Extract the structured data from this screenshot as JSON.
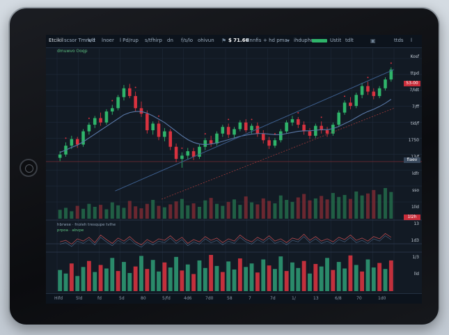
{
  "toolbar": {
    "items": [
      "Etcikil",
      "scsor Tmrwd",
      "k/lt",
      "lnoer",
      "l Pd/rup",
      "s/tfhirp",
      "dn",
      "f/s/lo",
      "ohivun",
      "Ennfis",
      "+ hd pma",
      "ihdup",
      "ho",
      "Ustit",
      "tdlt",
      "ttds"
    ],
    "price": "$ 71.60",
    "mini_value": "l"
  },
  "subtitle": "dmuwvo Ooqp",
  "price_axis": {
    "labels": [
      "Kosf",
      "ttpd",
      "7/ldt",
      "7/ff",
      "tid/f",
      "1750",
      "13/f",
      "ldfr",
      "sso",
      "1lld",
      "13",
      "1d3",
      "1/3",
      "lld"
    ],
    "badges": [
      "53-00",
      "fiaev",
      "1l2h"
    ]
  },
  "indicator_title": "hbrwse · fnoleh tresqupe tvlhe",
  "indicator_sub": "prpoa · abvpe",
  "time_axis": [
    "Hifd",
    "5ld",
    "fd",
    "5d",
    "80",
    "5/fd",
    "4d6",
    "7d0",
    "58",
    "7",
    "7d",
    "1/",
    "13",
    "6/8",
    "70",
    "1d0"
  ],
  "colors": {
    "up": "#2fb46a",
    "down": "#d8323f",
    "ma": "#5a79a8",
    "grid": "#1f2b3a"
  },
  "chart_data": {
    "type": "candlestick",
    "up_color": "#2fb46a",
    "down_color": "#d8323f",
    "candles": [
      {
        "o": 56.0,
        "h": 57.2,
        "l": 55.4,
        "c": 56.6
      },
      {
        "o": 56.6,
        "h": 58.8,
        "l": 56.2,
        "c": 58.2
      },
      {
        "o": 58.2,
        "h": 60.0,
        "l": 57.6,
        "c": 59.4
      },
      {
        "o": 59.4,
        "h": 59.8,
        "l": 57.8,
        "c": 58.4
      },
      {
        "o": 58.4,
        "h": 61.2,
        "l": 58.0,
        "c": 60.8
      },
      {
        "o": 60.8,
        "h": 62.4,
        "l": 60.2,
        "c": 62.0
      },
      {
        "o": 62.0,
        "h": 63.6,
        "l": 61.4,
        "c": 63.2
      },
      {
        "o": 63.2,
        "h": 64.2,
        "l": 61.8,
        "c": 62.4
      },
      {
        "o": 62.4,
        "h": 64.8,
        "l": 62.0,
        "c": 64.4
      },
      {
        "o": 64.4,
        "h": 65.6,
        "l": 63.8,
        "c": 65.0
      },
      {
        "o": 65.0,
        "h": 67.4,
        "l": 64.6,
        "c": 67.0
      },
      {
        "o": 67.0,
        "h": 69.2,
        "l": 66.4,
        "c": 68.6
      },
      {
        "o": 68.6,
        "h": 69.4,
        "l": 66.8,
        "c": 67.2
      },
      {
        "o": 67.2,
        "h": 68.0,
        "l": 64.4,
        "c": 65.0
      },
      {
        "o": 65.0,
        "h": 66.2,
        "l": 63.4,
        "c": 64.0
      },
      {
        "o": 64.0,
        "h": 64.6,
        "l": 60.4,
        "c": 61.0
      },
      {
        "o": 61.0,
        "h": 62.6,
        "l": 60.2,
        "c": 62.2
      },
      {
        "o": 62.2,
        "h": 62.8,
        "l": 59.2,
        "c": 59.8
      },
      {
        "o": 59.8,
        "h": 61.4,
        "l": 59.0,
        "c": 60.8
      },
      {
        "o": 60.8,
        "h": 61.2,
        "l": 57.4,
        "c": 58.0
      },
      {
        "o": 58.0,
        "h": 58.6,
        "l": 55.2,
        "c": 55.8
      },
      {
        "o": 55.8,
        "h": 57.0,
        "l": 54.2,
        "c": 56.4
      },
      {
        "o": 56.4,
        "h": 57.8,
        "l": 55.8,
        "c": 57.2
      },
      {
        "o": 57.2,
        "h": 57.8,
        "l": 55.6,
        "c": 56.2
      },
      {
        "o": 56.2,
        "h": 58.4,
        "l": 55.8,
        "c": 58.0
      },
      {
        "o": 58.0,
        "h": 59.6,
        "l": 57.4,
        "c": 59.2
      },
      {
        "o": 59.2,
        "h": 60.0,
        "l": 58.0,
        "c": 58.6
      },
      {
        "o": 58.6,
        "h": 60.8,
        "l": 58.2,
        "c": 60.4
      },
      {
        "o": 60.4,
        "h": 62.0,
        "l": 59.8,
        "c": 61.6
      },
      {
        "o": 61.6,
        "h": 62.2,
        "l": 59.6,
        "c": 60.2
      },
      {
        "o": 60.2,
        "h": 61.6,
        "l": 59.6,
        "c": 61.2
      },
      {
        "o": 61.2,
        "h": 62.8,
        "l": 60.8,
        "c": 62.4
      },
      {
        "o": 62.4,
        "h": 63.0,
        "l": 60.6,
        "c": 61.0
      },
      {
        "o": 61.0,
        "h": 62.2,
        "l": 60.4,
        "c": 61.8
      },
      {
        "o": 61.8,
        "h": 62.4,
        "l": 59.8,
        "c": 60.4
      },
      {
        "o": 60.4,
        "h": 61.0,
        "l": 58.6,
        "c": 59.2
      },
      {
        "o": 59.2,
        "h": 59.8,
        "l": 57.6,
        "c": 58.2
      },
      {
        "o": 58.2,
        "h": 59.6,
        "l": 57.8,
        "c": 59.2
      },
      {
        "o": 59.2,
        "h": 61.2,
        "l": 58.8,
        "c": 60.8
      },
      {
        "o": 60.8,
        "h": 62.8,
        "l": 60.4,
        "c": 62.4
      },
      {
        "o": 62.4,
        "h": 63.6,
        "l": 61.8,
        "c": 63.0
      },
      {
        "o": 63.0,
        "h": 63.4,
        "l": 61.4,
        "c": 62.0
      },
      {
        "o": 62.0,
        "h": 62.6,
        "l": 60.2,
        "c": 60.8
      },
      {
        "o": 60.8,
        "h": 61.4,
        "l": 59.4,
        "c": 60.0
      },
      {
        "o": 60.0,
        "h": 62.2,
        "l": 59.6,
        "c": 61.8
      },
      {
        "o": 61.8,
        "h": 62.6,
        "l": 60.4,
        "c": 61.0
      },
      {
        "o": 61.0,
        "h": 61.6,
        "l": 59.8,
        "c": 60.4
      },
      {
        "o": 60.4,
        "h": 62.4,
        "l": 60.0,
        "c": 62.0
      },
      {
        "o": 62.0,
        "h": 64.6,
        "l": 61.6,
        "c": 64.2
      },
      {
        "o": 64.2,
        "h": 66.4,
        "l": 63.8,
        "c": 66.0
      },
      {
        "o": 66.0,
        "h": 67.0,
        "l": 64.8,
        "c": 65.4
      },
      {
        "o": 65.4,
        "h": 67.8,
        "l": 65.0,
        "c": 67.4
      },
      {
        "o": 67.4,
        "h": 69.6,
        "l": 66.8,
        "c": 69.0
      },
      {
        "o": 69.0,
        "h": 69.8,
        "l": 67.4,
        "c": 68.0
      },
      {
        "o": 68.0,
        "h": 68.6,
        "l": 66.6,
        "c": 67.2
      },
      {
        "o": 67.2,
        "h": 69.0,
        "l": 66.8,
        "c": 68.6
      },
      {
        "o": 68.6,
        "h": 70.6,
        "l": 68.2,
        "c": 70.2
      },
      {
        "o": 70.2,
        "h": 72.4,
        "l": 69.8,
        "c": 72.0
      }
    ],
    "ma_line": [
      57.0,
      57.4,
      57.9,
      58.3,
      58.9,
      59.6,
      60.3,
      61.0,
      61.7,
      62.4,
      63.1,
      63.8,
      64.2,
      64.4,
      64.4,
      64.1,
      63.6,
      63.0,
      62.4,
      61.6,
      60.8,
      60.0,
      59.3,
      58.8,
      58.5,
      58.4,
      58.5,
      58.7,
      59.0,
      59.3,
      59.6,
      59.9,
      60.1,
      60.3,
      60.4,
      60.4,
      60.3,
      60.2,
      60.2,
      60.4,
      60.6,
      60.8,
      60.9,
      60.9,
      61.0,
      61.1,
      61.1,
      61.3,
      61.7,
      62.2,
      62.7,
      63.3,
      63.9,
      64.4,
      64.8,
      65.3,
      65.9,
      66.6
    ],
    "trend_line": [
      50.0,
      72.0
    ],
    "ylim": [
      48,
      74
    ],
    "volume": [
      18,
      22,
      15,
      26,
      20,
      30,
      24,
      28,
      19,
      33,
      27,
      22,
      36,
      25,
      21,
      30,
      38,
      26,
      23,
      29,
      35,
      40,
      27,
      31,
      24,
      37,
      42,
      30,
      26,
      34,
      39,
      28,
      45,
      33,
      29,
      41,
      36,
      31,
      47,
      38,
      34,
      43,
      50,
      37,
      41,
      46,
      39,
      52,
      44,
      48,
      40,
      55,
      47,
      51,
      58,
      49,
      62,
      54
    ],
    "volume_colors": "mixed",
    "oscillator": [
      46,
      48,
      43,
      50,
      47,
      52,
      45,
      55,
      49,
      44,
      51,
      47,
      53,
      46,
      42,
      49,
      45,
      50,
      48,
      54,
      47,
      52,
      44,
      49,
      46,
      53,
      48,
      51,
      45,
      50,
      47,
      55,
      49,
      46,
      52,
      48,
      54,
      47,
      50,
      45,
      51,
      49,
      56,
      48,
      53,
      47,
      50,
      46,
      52,
      49,
      55,
      48,
      51,
      47,
      53,
      50,
      57,
      52
    ],
    "histogram": [
      42,
      35,
      55,
      30,
      48,
      60,
      38,
      52,
      45,
      66,
      40,
      58,
      36,
      49,
      70,
      44,
      62,
      39,
      57,
      47,
      68,
      41,
      53,
      34,
      61,
      46,
      72,
      50,
      38,
      59,
      43,
      65,
      48,
      55,
      37,
      63,
      51,
      44,
      69,
      40,
      57,
      46,
      60,
      35,
      54,
      49,
      66,
      42,
      58,
      45,
      71,
      52,
      39,
      63,
      47,
      56,
      44,
      61
    ],
    "histogram_colors_pattern": [
      "up",
      "up",
      "down",
      "up",
      "up",
      "down",
      "up",
      "down",
      "up",
      "up",
      "down",
      "up",
      "up",
      "down",
      "up",
      "down",
      "up",
      "up",
      "down",
      "up",
      "up",
      "down",
      "up",
      "down",
      "up",
      "up",
      "down",
      "up",
      "down",
      "up",
      "up",
      "down",
      "up",
      "up",
      "down",
      "up",
      "down",
      "up",
      "up",
      "down",
      "up",
      "up",
      "down",
      "up",
      "down",
      "up",
      "up",
      "down",
      "up",
      "up",
      "down",
      "up",
      "down",
      "up",
      "up",
      "down",
      "up",
      "down"
    ]
  }
}
